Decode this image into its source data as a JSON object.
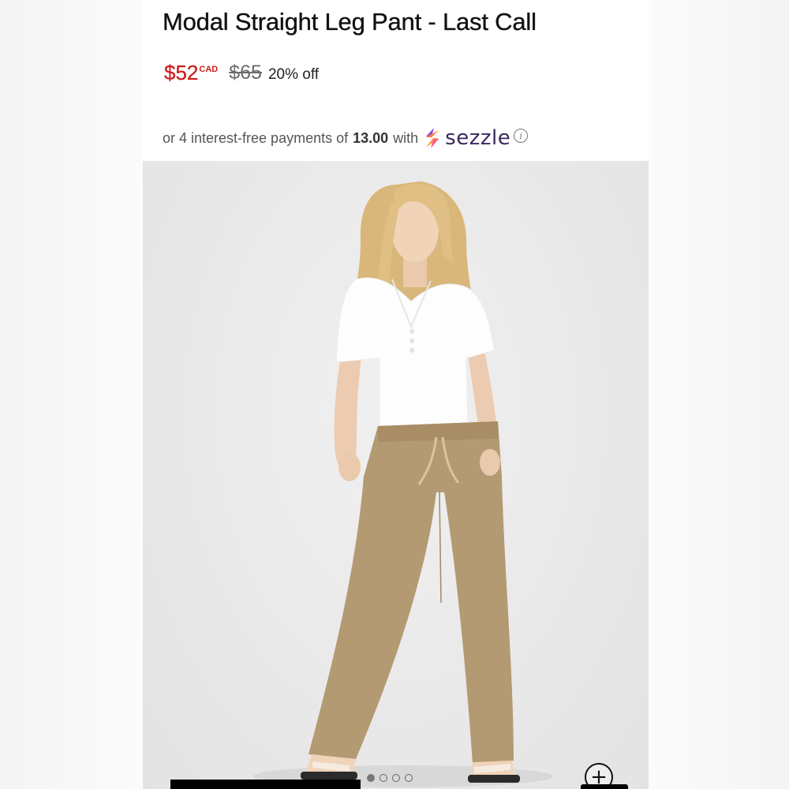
{
  "product": {
    "title": "Modal Straight Leg Pant - Last Call",
    "sale_price": "$52",
    "currency": "CAD",
    "original_price": "$65",
    "discount": "20% off"
  },
  "installments": {
    "prefix": "or 4 interest-free payments of",
    "amount": "13.00",
    "suffix": "with",
    "provider": "sezzle",
    "info_glyph": "i"
  },
  "gallery": {
    "zoom_glyph": "+",
    "slide_count": 4,
    "active_slide": 1
  },
  "colors": {
    "sale": "#cc1f1f",
    "strikethrough": "#6b6b6b",
    "sezzle": "#3a2a5c",
    "pants": "#b49a72"
  }
}
